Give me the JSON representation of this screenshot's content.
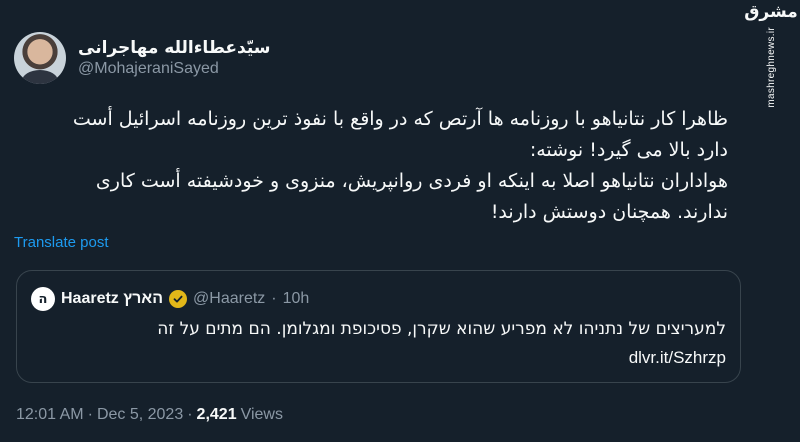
{
  "tweet": {
    "display_name": "سیّدعطاءالله مهاجرانی",
    "handle": "@MohajeraniSayed",
    "lines": [
      "ظاهرا کار نتانیاهو با روزنامه ها آرتص که در واقع با نفوذ ترین روزنامه اسرائیل أست",
      "دارد بالا می گیرد! نوشته:",
      "هواداران نتانیاهو اصلا به اینکه او فردی روانپریش، منزوی و خودشیفته أست کاری",
      "ندارند. همچنان دوستش دارند!"
    ],
    "translate_label": "Translate post",
    "time": "12:01 AM",
    "separator": "·",
    "date": "Dec 5, 2023",
    "views_count": "2,421",
    "views_label": "Views"
  },
  "quote": {
    "avatar_letter": "ה",
    "name": "Haaretz הארץ",
    "handle": "@Haaretz",
    "separator": "·",
    "time": "10h",
    "line1": "למעריצים של נתניהו לא מפריע שהוא שקרן, פסיכופת ומגלומן. הם מתים על זה",
    "link": "dlvr.it/Szhrzp",
    "badge_color": "#e2b719"
  },
  "watermark": {
    "logo": "مشرق",
    "url": "mashreghnews.ir"
  },
  "colors": {
    "background": "#15202b",
    "link": "#1d9bf0",
    "muted": "#8b98a5"
  }
}
